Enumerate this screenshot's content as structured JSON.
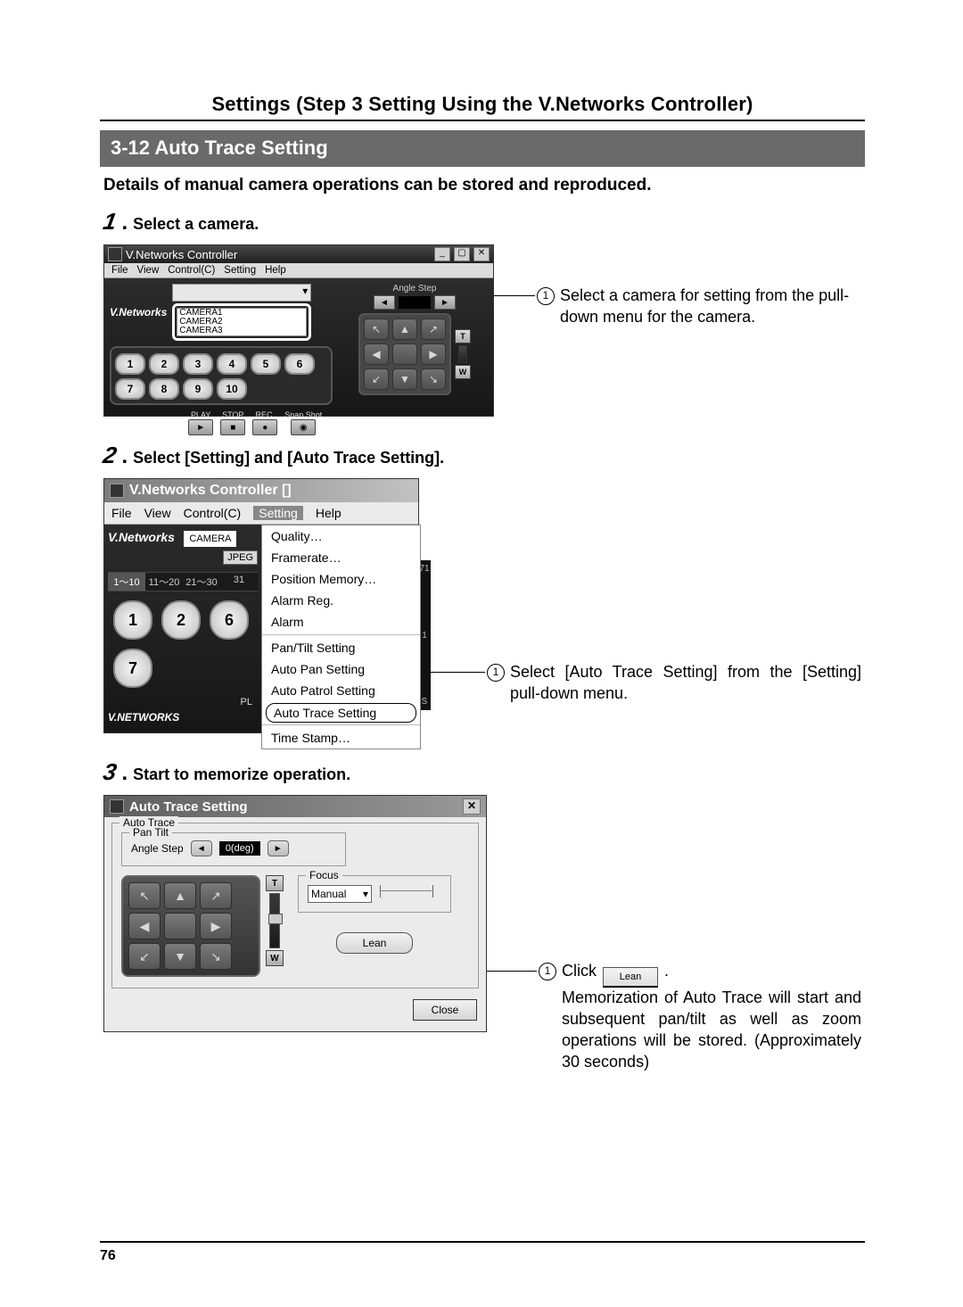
{
  "header": "Settings (Step 3 Setting Using the V.Networks Controller)",
  "section_title": "3-12 Auto Trace Setting",
  "intro": "Details of manual camera operations can be stored and reproduced.",
  "steps": {
    "s1": {
      "num": "1",
      "text": "Select a camera."
    },
    "s2": {
      "num": "2",
      "text": "Select [Setting] and [Auto Trace Setting]."
    },
    "s3": {
      "num": "3",
      "text": "Start to memorize operation."
    }
  },
  "callouts": {
    "c1": "Select a camera for setting from the pull-down menu for the camera.",
    "c2": "Select [Auto Trace Setting] from the [Setting] pull-down menu.",
    "c3_pre": "Click ",
    "c3_btn": "Lean",
    "c3_post": ".",
    "c3_body": "Memorization of Auto Trace will start and subsequent pan/tilt as well as zoom operations will be stored. (Approximately 30 seconds)"
  },
  "shot1": {
    "title": "V.Networks Controller",
    "menus": [
      "File",
      "View",
      "Control(C)",
      "Setting",
      "Help"
    ],
    "vn_label": "V.Networks",
    "cam_options": [
      "CAMERA1",
      "CAMERA2",
      "CAMERA3"
    ],
    "num_buttons": [
      "1",
      "2",
      "3",
      "4",
      "5",
      "6",
      "7",
      "8",
      "9",
      "10"
    ],
    "angle_label": "Angle Step",
    "media": [
      "PLAY",
      "STOP",
      "REC.",
      "Snap Shot"
    ],
    "tw": {
      "t": "T",
      "w": "W"
    },
    "logo": "V.NETWORKS"
  },
  "shot2": {
    "title": "V.Networks Controller  []",
    "menus": [
      "File",
      "View",
      "Control(C)",
      "Setting",
      "Help"
    ],
    "vn_label": "V.Networks",
    "mode1": "CAMERA",
    "mode2": "JPEG",
    "tabs": [
      "1～10",
      "11～20",
      "21～30",
      "31"
    ],
    "pl": "PL",
    "big_nums": [
      "1",
      "2",
      "6",
      "7"
    ],
    "side_num": "1",
    "side_s": "S",
    "side_71": "71",
    "logo": "V.NETWORKS",
    "menu_items": [
      "Quality…",
      "Framerate…",
      "Position Memory…",
      "Alarm Reg.",
      "Alarm",
      "Pan/Tilt Setting",
      "Auto Pan Setting",
      "Auto Patrol Setting",
      "Auto Trace Setting",
      "Time Stamp…"
    ]
  },
  "shot3": {
    "title": "Auto Trace Setting",
    "gb_auto": "Auto Trace",
    "gb_pantilt": "Pan Tilt",
    "angle_label": "Angle Step",
    "angle_value": "0(deg)",
    "tw": {
      "t": "T",
      "w": "W"
    },
    "gb_focus": "Focus",
    "focus_mode": "Manual",
    "lean": "Lean",
    "close": "Close"
  },
  "page_number": "76"
}
